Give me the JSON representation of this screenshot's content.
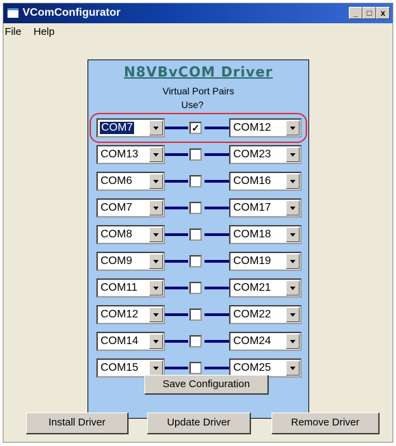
{
  "window": {
    "title": "VComConfigurator",
    "controls": {
      "minimize": "_",
      "maximize": "□",
      "close": "x"
    }
  },
  "menu": {
    "items": [
      "File",
      "Help"
    ]
  },
  "panel": {
    "title": "N8VBvCOM Driver",
    "subtitle": "Virtual Port Pairs",
    "use_label": "Use?",
    "pairs": [
      {
        "left": "COM7",
        "right": "COM12",
        "use": true
      },
      {
        "left": "COM13",
        "right": "COM23",
        "use": false
      },
      {
        "left": "COM6",
        "right": "COM16",
        "use": false
      },
      {
        "left": "COM7",
        "right": "COM17",
        "use": false
      },
      {
        "left": "COM8",
        "right": "COM18",
        "use": false
      },
      {
        "left": "COM9",
        "right": "COM19",
        "use": false
      },
      {
        "left": "COM11",
        "right": "COM21",
        "use": false
      },
      {
        "left": "COM12",
        "right": "COM22",
        "use": false
      },
      {
        "left": "COM14",
        "right": "COM24",
        "use": false
      },
      {
        "left": "COM15",
        "right": "COM25",
        "use": false
      }
    ],
    "save_label": "Save Configuration"
  },
  "buttons": {
    "install": "Install Driver",
    "update": "Update Driver",
    "remove": "Remove Driver"
  },
  "colors": {
    "panel_bg": "#a6caf0",
    "title_bar": "#0a246a",
    "link_line": "#00007a",
    "highlight": "#e0303a"
  }
}
